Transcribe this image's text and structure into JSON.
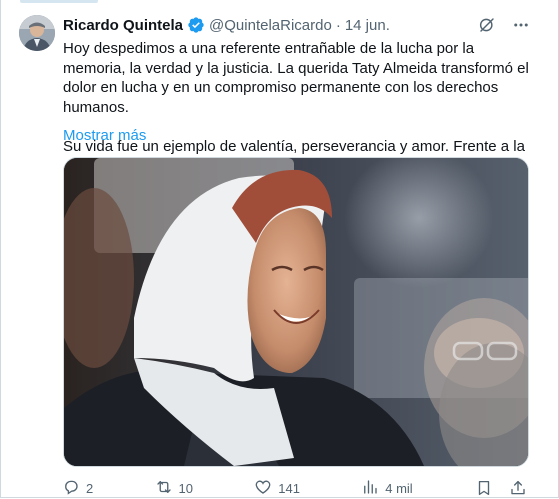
{
  "tweet": {
    "author_name": "Ricardo Quintela",
    "handle": "@QuintelaRicardo",
    "separator": "·",
    "date": "14 jun.",
    "paragraphs": [
      "Hoy despedimos a una referente entrañable de la lucha por la memoria, la verdad y la justicia. La querida Taty Almeida transformó el dolor en lucha y en un compromiso permanente con los derechos humanos.",
      "Su vida fue un ejemplo de valentía, perseverancia y amor. Frente a la"
    ],
    "show_more": "Mostrar más",
    "media_alt": "photo-of-smiling-woman-with-white-headscarf"
  },
  "actions": {
    "replies": "2",
    "reposts": "10",
    "likes": "141",
    "views": "4 mil"
  },
  "icons": {
    "verified": "verified-badge-icon",
    "grok": "grok-icon",
    "more": "more-icon",
    "reply": "reply-icon",
    "repost": "repost-icon",
    "like": "heart-icon",
    "views": "views-icon",
    "bookmark": "bookmark-icon",
    "share": "share-icon"
  },
  "colors": {
    "text": "#0f1419",
    "secondary": "#536471",
    "link": "#1d9bf0",
    "border": "#cfd9de"
  }
}
